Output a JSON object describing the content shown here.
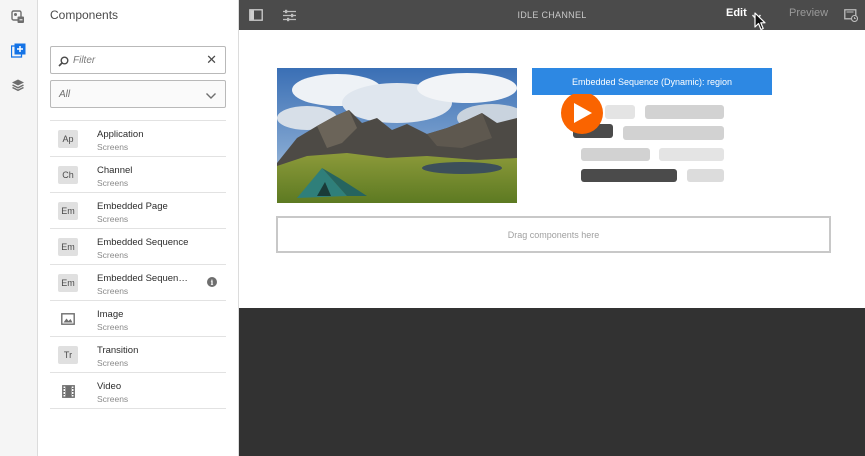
{
  "rail": {
    "icons": [
      "assets-icon",
      "add-component-icon",
      "layers-icon"
    ]
  },
  "panel": {
    "title": "Components",
    "filter": {
      "placeholder": "Filter",
      "value": ""
    },
    "select": {
      "value": "All"
    },
    "items": [
      {
        "badge": "Ap",
        "name": "Application",
        "group": "Screens"
      },
      {
        "badge": "Ch",
        "name": "Channel",
        "group": "Screens"
      },
      {
        "badge": "Em",
        "name": "Embedded Page",
        "group": "Screens"
      },
      {
        "badge": "Em",
        "name": "Embedded Sequence",
        "group": "Screens"
      },
      {
        "badge": "Em",
        "name": "Embedded Sequenc...",
        "group": "Screens",
        "info": "i"
      },
      {
        "badge": "",
        "name": "Image",
        "group": "Screens",
        "icon": "image-icon"
      },
      {
        "badge": "Tr",
        "name": "Transition",
        "group": "Screens"
      },
      {
        "badge": "",
        "name": "Video",
        "group": "Screens",
        "icon": "film-icon"
      }
    ]
  },
  "topbar": {
    "title": "IDLE CHANNEL",
    "edit_label": "Edit",
    "preview_label": "Preview"
  },
  "canvas": {
    "embed_label": "Embedded Sequence (Dynamic): region",
    "dropzone_label": "Drag components here"
  },
  "colors": {
    "accent_blue": "#2d88e3",
    "play_orange": "#fa6400",
    "topbar": "#4b4b4b",
    "workspace": "#323232"
  }
}
